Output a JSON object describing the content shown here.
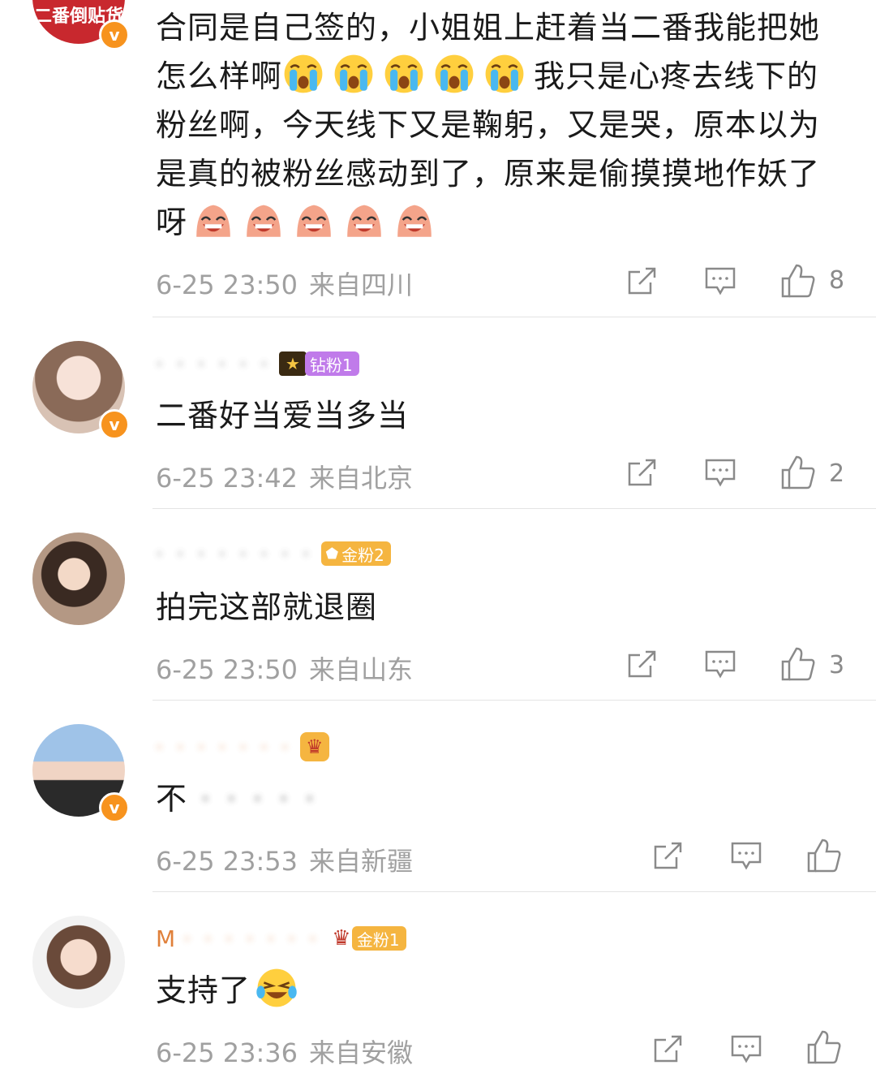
{
  "top_avatar_text": "二番倒贴货",
  "comments": [
    {
      "text": "合同是自己签的，小姐姐上赶着当二番我能把她怎么样啊",
      "text_mid": "我只是心疼去线下的粉丝啊，今天线下又是鞠躬，又是哭，原本以为是真的被粉丝感动到了，原来是偷摸摸地作妖了呀",
      "time": "6-25 23:50",
      "region": "来自四川",
      "likes": "8"
    },
    {
      "badge": "钻粉1",
      "text": "二番好当爱当多当",
      "time": "6-25 23:42",
      "region": "来自北京",
      "likes": "2"
    },
    {
      "badge": "金粉2",
      "text": "拍完这部就退圈",
      "time": "6-25 23:50",
      "region": "来自山东",
      "likes": "3"
    },
    {
      "text": "不",
      "time": "6-25 23:53",
      "region": "来自新疆",
      "likes": ""
    },
    {
      "username": "M",
      "badge": "金粉1",
      "text": "支持了",
      "time": "6-25 23:36",
      "region": "来自安徽",
      "likes": ""
    }
  ],
  "verified_mark": "v",
  "colors": {
    "accent": "#e0803a",
    "verified": "#f7931e",
    "diamond_badge": "#c07bea",
    "gold_badge": "#f5b540"
  }
}
